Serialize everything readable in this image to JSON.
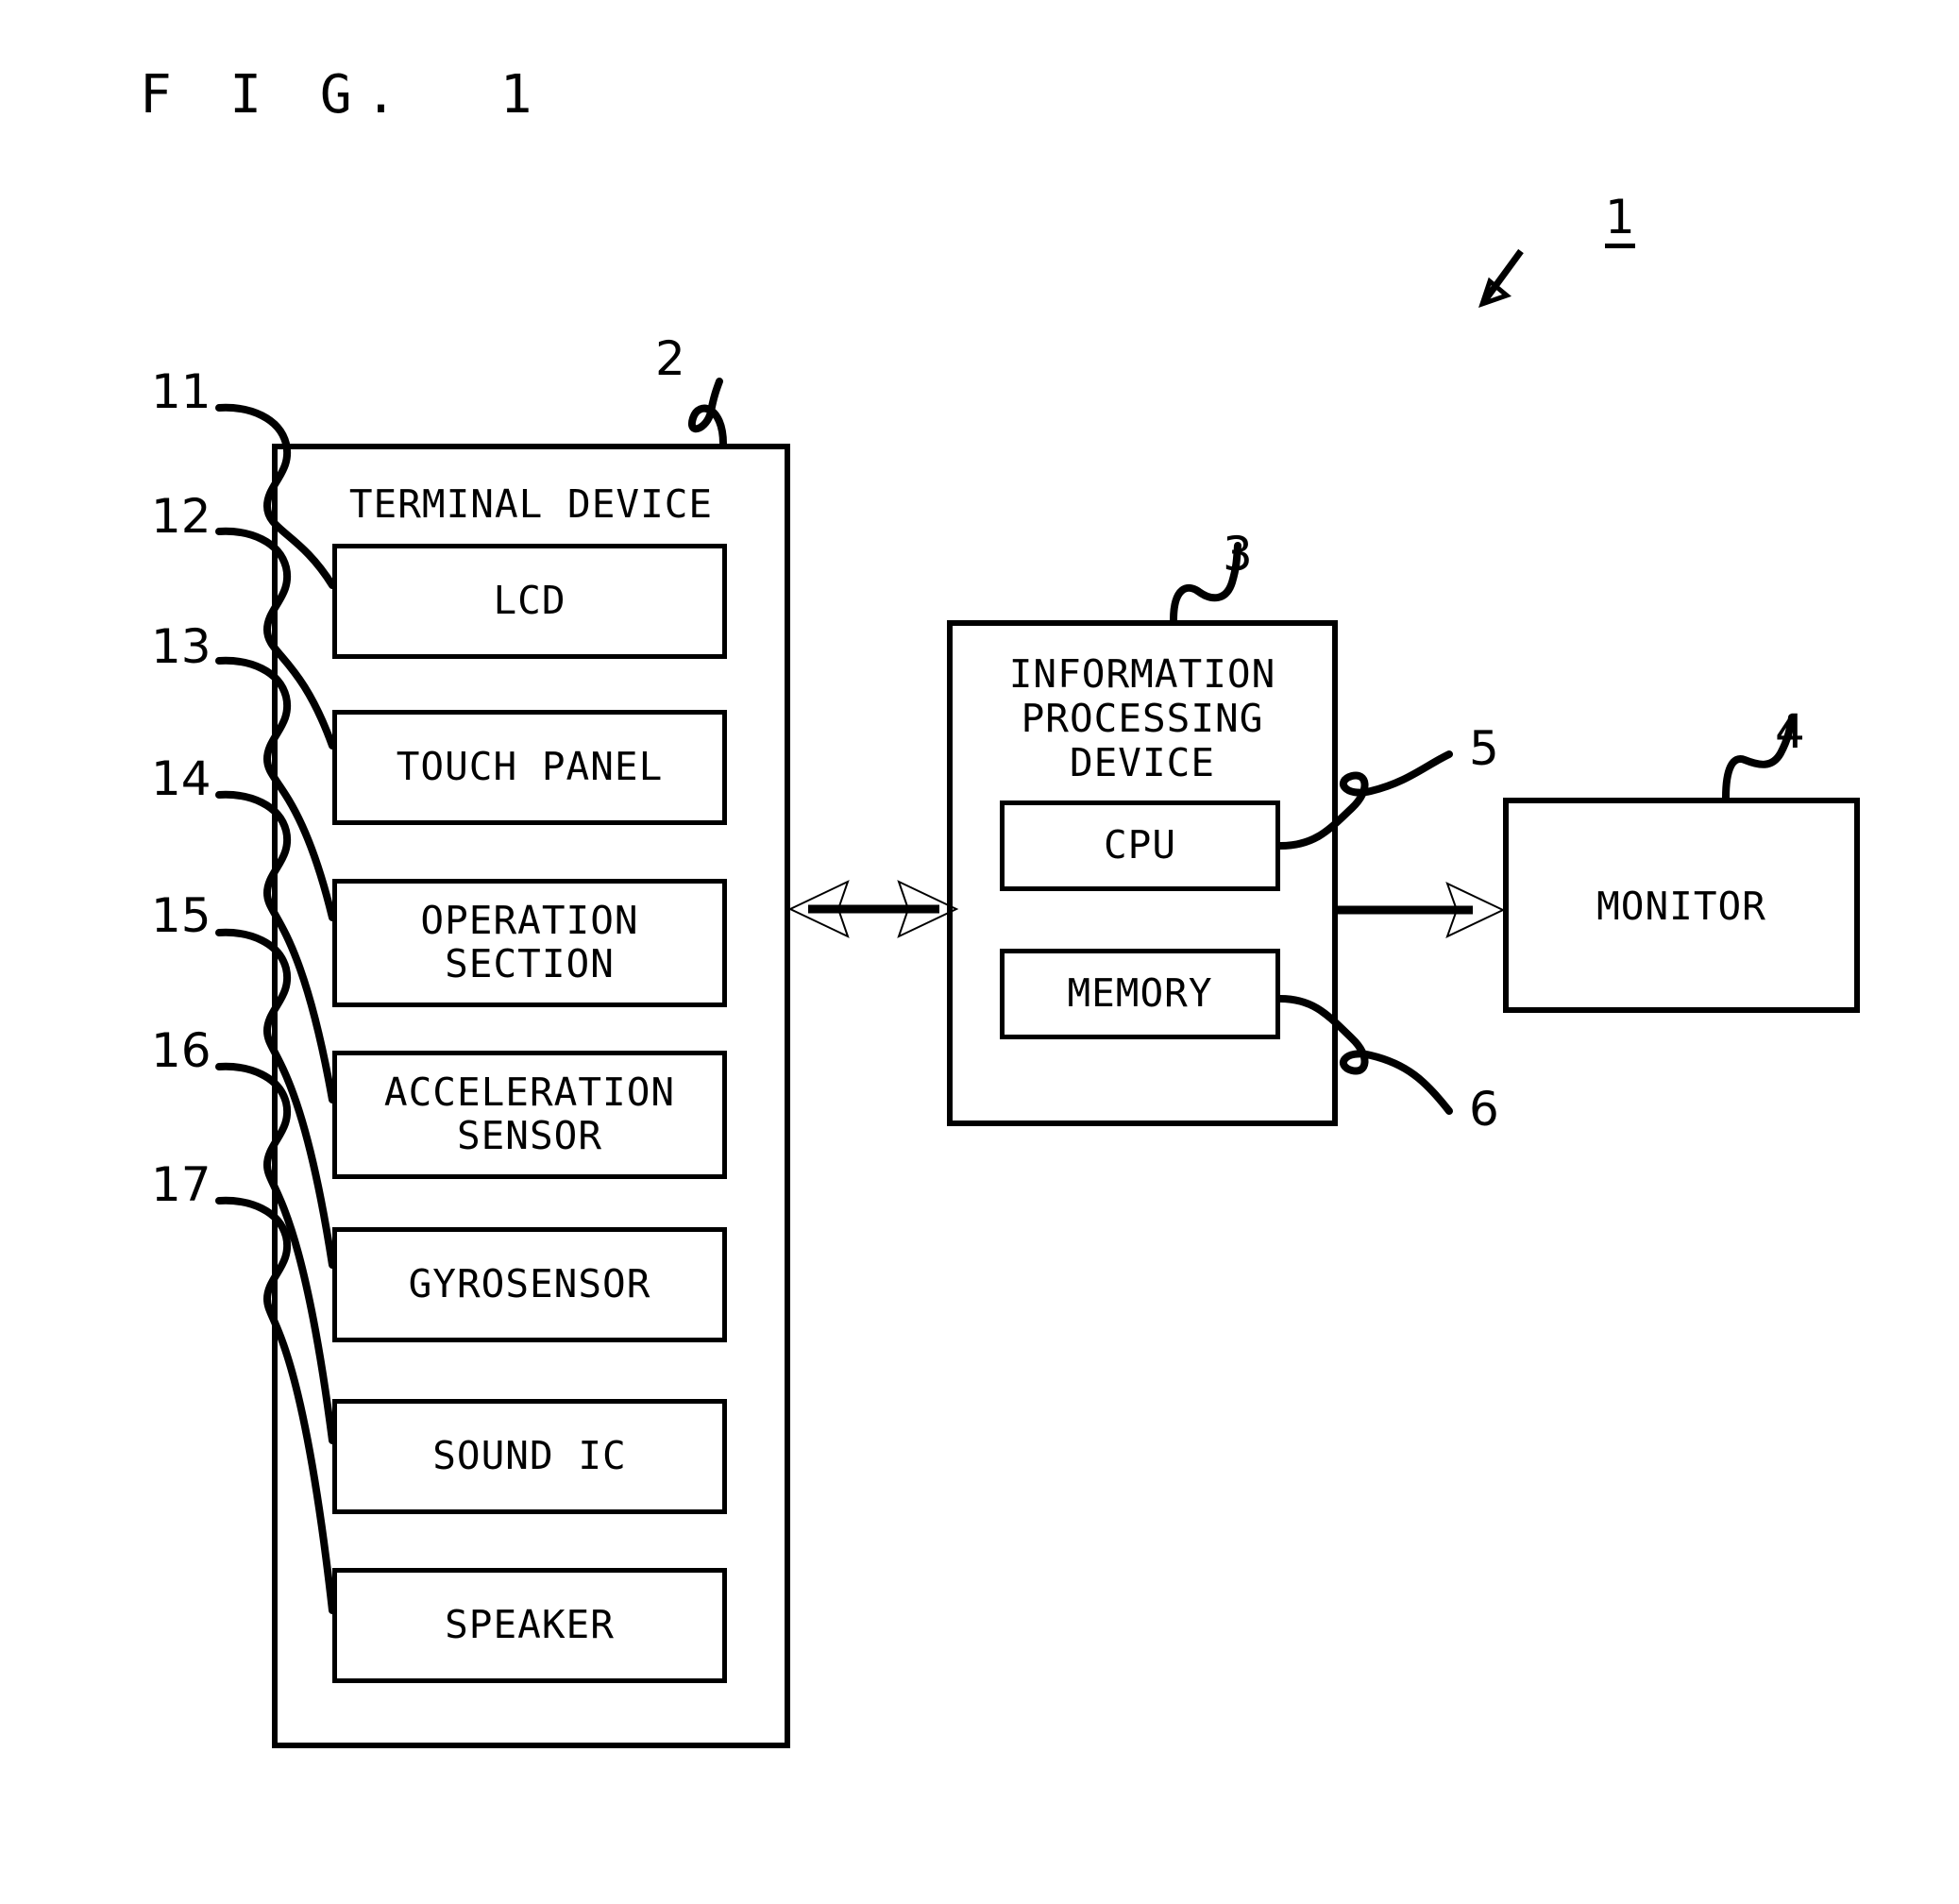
{
  "figure": {
    "title": "F I G.  1",
    "system_ref": "1"
  },
  "terminal_device": {
    "title": "TERMINAL DEVICE",
    "ref": "2",
    "components": [
      {
        "ref": "11",
        "label": "LCD"
      },
      {
        "ref": "12",
        "label": "TOUCH PANEL"
      },
      {
        "ref": "13",
        "label": "OPERATION\nSECTION"
      },
      {
        "ref": "14",
        "label": "ACCELERATION\nSENSOR"
      },
      {
        "ref": "15",
        "label": "GYROSENSOR"
      },
      {
        "ref": "16",
        "label": "SOUND IC"
      },
      {
        "ref": "17",
        "label": "SPEAKER"
      }
    ]
  },
  "information_processing_device": {
    "title": "INFORMATION\nPROCESSING\nDEVICE",
    "ref": "3",
    "components": [
      {
        "ref": "5",
        "label": "CPU"
      },
      {
        "ref": "6",
        "label": "MEMORY"
      }
    ]
  },
  "monitor": {
    "label": "MONITOR",
    "ref": "4"
  },
  "connections": [
    {
      "from": "terminal-device",
      "to": "information-processing-device",
      "style": "bidirectional-arrow"
    },
    {
      "from": "information-processing-device",
      "to": "monitor",
      "style": "arrow"
    }
  ],
  "colors": {
    "stroke": "#000000",
    "background": "#ffffff"
  }
}
